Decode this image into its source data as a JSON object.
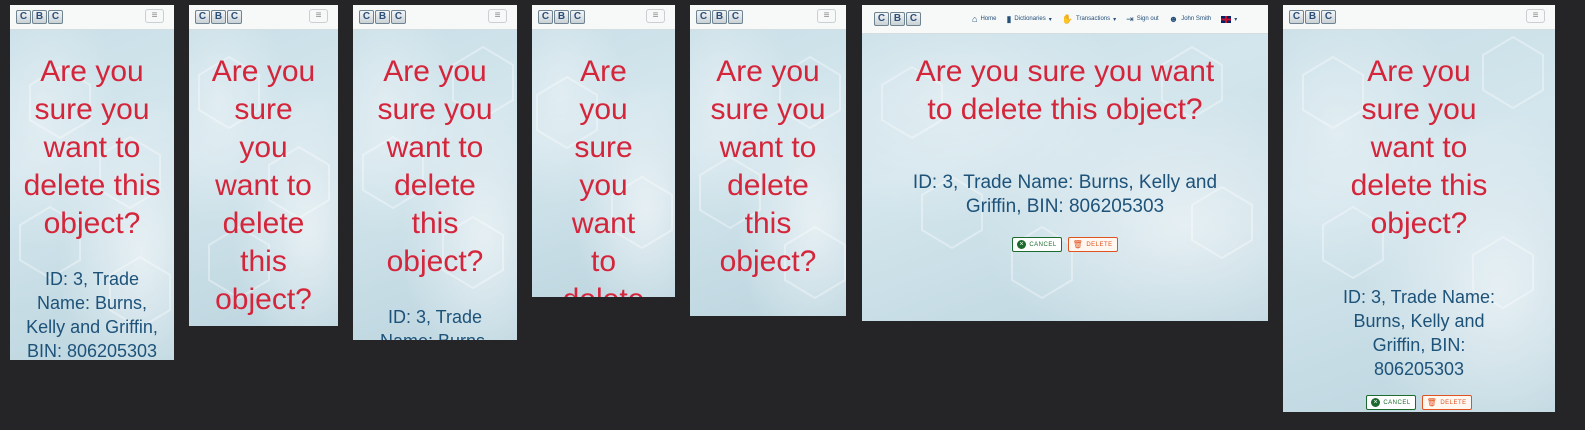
{
  "logo_letters": [
    "C",
    "B",
    "C"
  ],
  "dialog": {
    "question": "Are you sure you want to delete this object?",
    "record": "ID: 3, Trade Name: Burns, Kelly and Griffin, BIN: 806205303",
    "cancel_label": "CANCEL",
    "delete_label": "DELETE"
  },
  "nav": {
    "home": "Home",
    "dictionaries": "Dictionaries",
    "transactions": "Transactions",
    "sign_out": "Sign out",
    "user": "John Smith"
  },
  "colors": {
    "page_bg": "#252527",
    "question": "#d4253b",
    "record_text": "#1d5279",
    "cancel": "#1e6b2f",
    "delete": "#e0521f"
  },
  "icons": {
    "menu": "hamburger-icon",
    "home": "home-icon",
    "dictionaries": "book-icon",
    "transactions": "hand-coin-icon",
    "sign_out": "sign-out-icon",
    "user": "user-gear-icon",
    "language": "uk-flag-icon"
  }
}
